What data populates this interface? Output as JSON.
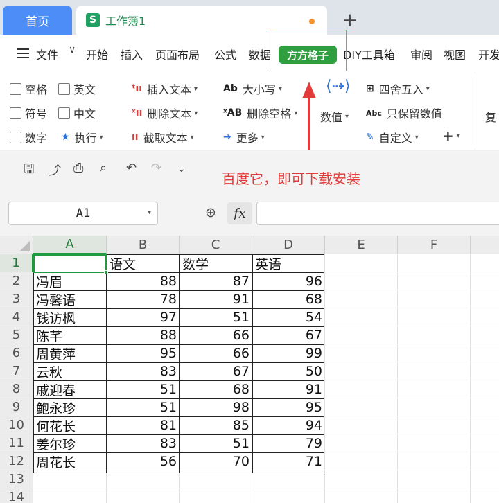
{
  "tabs": {
    "home_label": "首页",
    "doc_icon": "S",
    "doc_title": "工作簿1",
    "new_tab_label": "+"
  },
  "menu": {
    "file_label": "文件",
    "chevron": "∨",
    "items": [
      "开始",
      "插入",
      "页面布局",
      "公式",
      "数据",
      "方方格子",
      "DIY工具箱",
      "审阅",
      "视图",
      "开发"
    ],
    "highlight_color": "#2f9e3f"
  },
  "ribbon": {
    "checkboxes": [
      "空格",
      "英文",
      "符号",
      "中文",
      "数字"
    ],
    "execute_label": "执行",
    "insert_text": "插入文本",
    "delete_text": "删除文本",
    "extract_text": "截取文本",
    "case_label": "大小写",
    "delete_space": "删除空格",
    "more_label": "更多",
    "numeric_label": "数值",
    "round_label": "四舍五入",
    "keep_numeric": "只保留数值",
    "custom_label": "自定义",
    "plus_label": "+",
    "copy_label": "复",
    "icon_insert": "ᵗıı",
    "icon_delete": "ˣıı",
    "icon_extract": "ıı",
    "icon_case": "Ab",
    "icon_delete_space": "ˣAB",
    "icon_more": "➔",
    "icon_abc": "Abc"
  },
  "annotation": {
    "text": "百度它，即可下载安装",
    "color": "#e23b3b"
  },
  "formula_bar": {
    "cell_ref": "A1",
    "fx_label": "fx",
    "formula_value": ""
  },
  "sheet": {
    "columns": [
      "A",
      "B",
      "C",
      "D",
      "E",
      "F"
    ],
    "rows": [
      "1",
      "2",
      "3",
      "4",
      "5",
      "6",
      "7",
      "8",
      "9",
      "10",
      "11",
      "12",
      "13",
      "14"
    ],
    "header": [
      "",
      "语文",
      "数学",
      "英语"
    ],
    "data": [
      [
        "冯眉",
        "88",
        "87",
        "96"
      ],
      [
        "冯馨语",
        "78",
        "91",
        "68"
      ],
      [
        "钱访枫",
        "97",
        "51",
        "54"
      ],
      [
        "陈芊",
        "88",
        "66",
        "67"
      ],
      [
        "周黄萍",
        "95",
        "66",
        "99"
      ],
      [
        "云秋",
        "83",
        "67",
        "50"
      ],
      [
        "戚迎春",
        "51",
        "68",
        "91"
      ],
      [
        "鲍永珍",
        "51",
        "98",
        "95"
      ],
      [
        "何花长",
        "81",
        "85",
        "94"
      ],
      [
        "姜尔珍",
        "83",
        "51",
        "79"
      ],
      [
        "周花长",
        "56",
        "70",
        "71"
      ]
    ],
    "selection_color": "#1f9b3e"
  }
}
